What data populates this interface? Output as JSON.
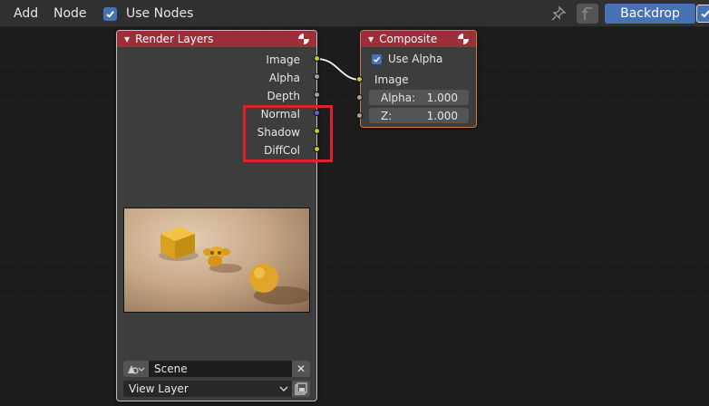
{
  "header": {
    "menu_add": "Add",
    "menu_node": "Node",
    "use_nodes_label": "Use Nodes",
    "use_nodes_checked": true,
    "backdrop_label": "Backdrop",
    "accent_color": "#4772b3",
    "icons": [
      "pin-icon",
      "parent-node-icon",
      "checkmark-icon"
    ]
  },
  "render_layers": {
    "title": "Render Layers",
    "outputs": [
      {
        "label": "Image",
        "socket_color": "#c7c729"
      },
      {
        "label": "Alpha",
        "socket_color": "#a1a1a1"
      },
      {
        "label": "Depth",
        "socket_color": "#a1a1a1"
      },
      {
        "label": "Normal",
        "socket_color": "#6363c7"
      },
      {
        "label": "Shadow",
        "socket_color": "#c7c729"
      },
      {
        "label": "DiffCol",
        "socket_color": "#c7c729"
      }
    ],
    "scene_value": "Scene",
    "view_layer_value": "View Layer",
    "header_color": "#9c2e3a"
  },
  "composite": {
    "title": "Composite",
    "use_alpha_label": "Use Alpha",
    "use_alpha_checked": true,
    "input_image_label": "Image",
    "alpha_field": {
      "label": "Alpha:",
      "value": "1.000"
    },
    "z_field": {
      "label": "Z:",
      "value": "1.000"
    },
    "border_color": "#d27a3c"
  },
  "annotation": {
    "highlight_color": "#e0202a"
  }
}
